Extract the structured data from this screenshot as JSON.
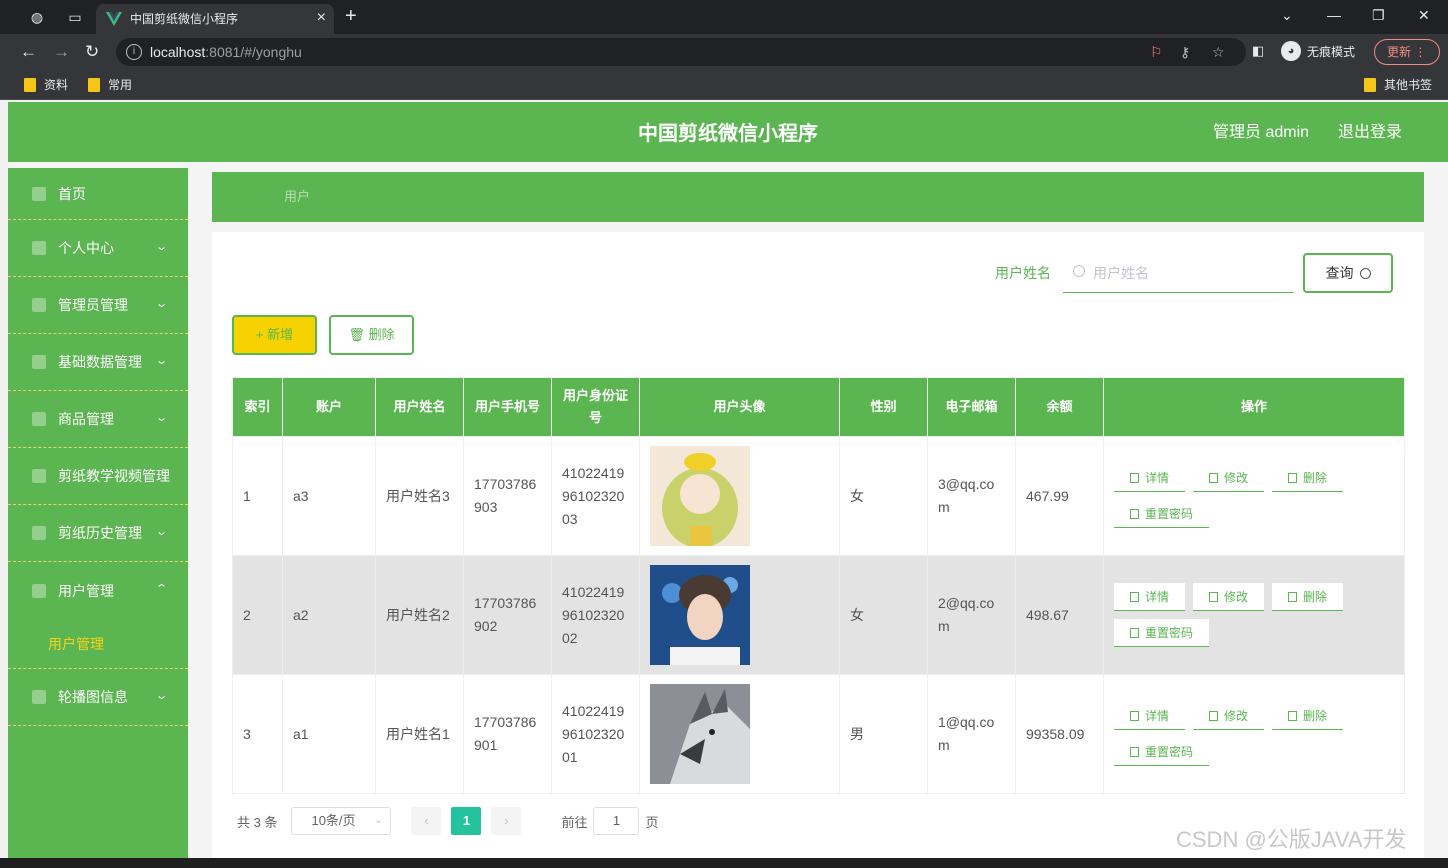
{
  "browser": {
    "tab_title": "中国剪纸微信小程序",
    "url_host": "localhost",
    "url_rest": ":8081/#/yonghu",
    "incognito_label": "无痕模式",
    "update_label": "更新",
    "bookmarks": [
      "资料",
      "常用"
    ],
    "other_bookmarks": "其他书签"
  },
  "header": {
    "title": "中国剪纸微信小程序",
    "admin": "管理员 admin",
    "logout": "退出登录"
  },
  "sidebar": {
    "items": [
      {
        "label": "首页",
        "icon": "home-icon",
        "arrow": ""
      },
      {
        "label": "个人中心",
        "icon": "user-icon",
        "arrow": "⌄"
      },
      {
        "label": "管理员管理",
        "icon": "admin-icon",
        "arrow": "⌄"
      },
      {
        "label": "基础数据管理",
        "icon": "data-icon",
        "arrow": "⌄"
      },
      {
        "label": "商品管理",
        "icon": "goods-icon",
        "arrow": "⌄"
      },
      {
        "label": "剪纸教学视频管理",
        "icon": "video-icon",
        "arrow": ""
      },
      {
        "label": "剪纸历史管理",
        "icon": "history-icon",
        "arrow": "⌄"
      },
      {
        "label": "用户管理",
        "icon": "users-icon",
        "arrow": "⌃"
      },
      {
        "label": "轮播图信息",
        "icon": "carousel-icon",
        "arrow": "⌄"
      }
    ],
    "submenu_label": "用户管理"
  },
  "breadcrumb": "用户",
  "search": {
    "label": "用户姓名",
    "placeholder": "用户姓名",
    "button": "查询"
  },
  "actions": {
    "add": "+ 新增",
    "delete": "删除"
  },
  "table": {
    "headers": [
      "索引",
      "账户",
      "用户姓名",
      "用户手机号",
      "用户身份证号",
      "用户头像",
      "性别",
      "电子邮箱",
      "余额",
      "操作"
    ],
    "rows": [
      {
        "index": "1",
        "account": "a3",
        "name": "用户姓名3",
        "phone": "17703786903",
        "idcard": "410224199610232003",
        "gender": "女",
        "email": "3@qq.com",
        "balance": "467.99"
      },
      {
        "index": "2",
        "account": "a2",
        "name": "用户姓名2",
        "phone": "17703786902",
        "idcard": "410224199610232002",
        "gender": "女",
        "email": "2@qq.com",
        "balance": "498.67"
      },
      {
        "index": "3",
        "account": "a1",
        "name": "用户姓名1",
        "phone": "17703786901",
        "idcard": "410224199610232001",
        "gender": "男",
        "email": "1@qq.com",
        "balance": "99358.09"
      }
    ],
    "ops": {
      "detail": "详情",
      "edit": "修改",
      "delete": "删除",
      "reset": "重置密码"
    }
  },
  "pager": {
    "total": "共 3 条",
    "page_size": "10条/页",
    "current": "1",
    "goto_label": "前往",
    "goto_value": "1",
    "page_unit": "页"
  },
  "watermark": "CSDN @公版JAVA开发",
  "colors": {
    "primary": "#5bb551",
    "accent_yellow": "#f5d200",
    "pager_current": "#24c39d"
  }
}
